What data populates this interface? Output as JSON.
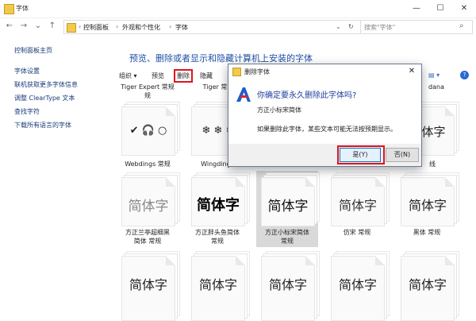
{
  "window": {
    "title": "字体",
    "minimize": "—",
    "maximize": "☐",
    "close": "✕"
  },
  "nav": {
    "back": "←",
    "forward": "→",
    "recent": "⌄",
    "up": "↑",
    "breadcrumb": [
      "控制面板",
      "外观和个性化",
      "字体"
    ],
    "search_placeholder": "搜索\"字体\""
  },
  "left_pane": {
    "home": "控制面板主页",
    "links": [
      "字体设置",
      "联机获取更多字体信息",
      "调整 ClearType 文本",
      "查找字符",
      "下载所有语言的字体"
    ]
  },
  "heading": "预览、删除或者显示和隐藏计算机上安装的字体",
  "toolbar": {
    "organize": "组织 ▾",
    "preview": "预览",
    "delete": "删除",
    "hide": "隐藏"
  },
  "top_row_partial": [
    {
      "label": "Tiger Expert 常规"
    },
    {
      "label": "Tiger 常"
    },
    {
      "label": "dana"
    }
  ],
  "tiles_row1": [
    {
      "glyph": "✔ 🎧 ○",
      "label": "Webdings 常规"
    },
    {
      "glyph": "❄ ❄ ❄",
      "label": "Wingdings"
    },
    {
      "glyph": "",
      "label": ""
    },
    {
      "glyph": "",
      "label": ""
    },
    {
      "glyph": "",
      "label": "线"
    }
  ],
  "tiles_row2": [
    {
      "glyph": "简体字",
      "label": "方正兰亭超细黑\n简体 常规"
    },
    {
      "glyph": "简体字",
      "label": "方正胖头鱼简体\n常规"
    },
    {
      "glyph": "简体字",
      "label": "方正小标宋简体\n常规"
    },
    {
      "glyph": "简体字",
      "label": "仿宋 常规"
    },
    {
      "glyph": "简体字",
      "label": "黑体 常规"
    }
  ],
  "tiles_row3": [
    {
      "glyph": "简体字"
    },
    {
      "glyph": "简体字"
    },
    {
      "glyph": "简体字"
    },
    {
      "glyph": "简体字"
    },
    {
      "glyph": "简体字"
    }
  ],
  "dialog": {
    "title": "删除字体",
    "close": "✕",
    "question": "你确定要永久删除此字体吗?",
    "font_name": "方正小标宋简体",
    "warning": "如果删除此字体，某些文本可能无法按预期显示。",
    "yes": "是(Y)",
    "no": "否(N)"
  },
  "colors": {
    "accent_red": "#e0141c",
    "link_blue": "#1a3c78",
    "heading_blue": "#1f4fa6"
  }
}
